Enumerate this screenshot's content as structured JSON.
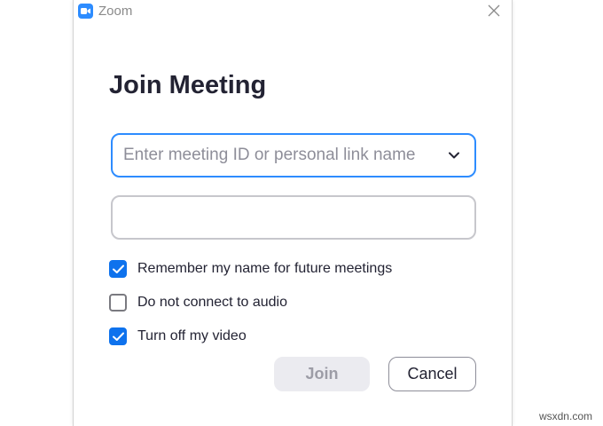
{
  "window": {
    "app_title": "Zoom",
    "app_icon": "zoom-camera-icon",
    "close_icon": "close-icon"
  },
  "dialog": {
    "heading": "Join Meeting",
    "meeting_id_field": {
      "value": "",
      "placeholder": "Enter meeting ID or personal link name",
      "dropdown_icon": "chevron-down-icon"
    },
    "name_field": {
      "value": "",
      "placeholder": ""
    },
    "options": [
      {
        "label": "Remember my name for future meetings",
        "checked": true
      },
      {
        "label": "Do not connect to audio",
        "checked": false
      },
      {
        "label": "Turn off my video",
        "checked": true
      }
    ],
    "join_label": "Join",
    "cancel_label": "Cancel"
  },
  "watermark": "wsxdn.com",
  "colors": {
    "accent": "#2d8cff",
    "checkbox": "#0e72ed",
    "heading_text": "#232333",
    "disabled_button_bg": "#ebebf0"
  }
}
